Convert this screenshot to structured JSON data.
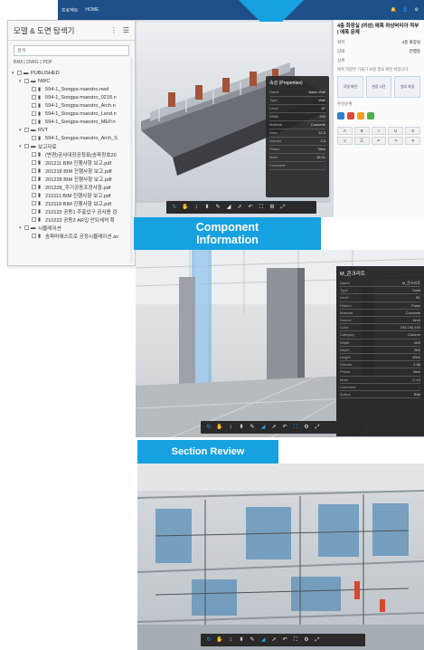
{
  "app": {
    "menu_label": "프로젝트",
    "home_label": "HOME"
  },
  "explorer": {
    "title": "모델 & 도면 탐색기",
    "search_placeholder": "검색",
    "filters": "BIM | DWG | PDF",
    "nodes": [
      {
        "level": 0,
        "toggle": "▾",
        "type": "folder",
        "label": "PUBLISHED"
      },
      {
        "level": 1,
        "toggle": "▾",
        "type": "folder",
        "label": "NWC"
      },
      {
        "level": 2,
        "toggle": "",
        "type": "file",
        "label": "594-1_Songpa maestro.nwd"
      },
      {
        "level": 2,
        "toggle": "",
        "type": "file",
        "label": "594-1_Songpa maestro_0218.n"
      },
      {
        "level": 2,
        "toggle": "",
        "type": "file",
        "label": "594-1_Songpa maestro_Arch.n"
      },
      {
        "level": 2,
        "toggle": "",
        "type": "file",
        "label": "594-1_Songpa maestro_Land.n"
      },
      {
        "level": 2,
        "toggle": "",
        "type": "file",
        "label": "594-1_Songpa maestro_MEP.n"
      },
      {
        "level": 1,
        "toggle": "▾",
        "type": "folder",
        "label": "RVT"
      },
      {
        "level": 2,
        "toggle": "",
        "type": "file",
        "label": "594-1_Songpa maestro_Arch_S"
      },
      {
        "level": 1,
        "toggle": "▾",
        "type": "folder",
        "label": "보고자료"
      },
      {
        "level": 2,
        "toggle": "",
        "type": "file",
        "label": "(변경)공사대장공정표(송파창호20"
      },
      {
        "level": 2,
        "toggle": "",
        "type": "file",
        "label": "201211 BIM 진행사항 보고.pdf"
      },
      {
        "level": 2,
        "toggle": "",
        "type": "file",
        "label": "201218 BIM 진행사항 보고.pdf"
      },
      {
        "level": 2,
        "toggle": "",
        "type": "file",
        "label": "201228 BIM 진행사항 보고.pdf"
      },
      {
        "level": 2,
        "toggle": "",
        "type": "file",
        "label": "201228_주기공동조정사항.pdf"
      },
      {
        "level": 2,
        "toggle": "",
        "type": "file",
        "label": "210111 BIM 진행사항 보고.pdf"
      },
      {
        "level": 2,
        "toggle": "",
        "type": "file",
        "label": "210118 BIM 진행사항 보고.pdf"
      },
      {
        "level": 2,
        "toggle": "",
        "type": "file",
        "label": "210122 공동1 주출입구 공사용 검"
      },
      {
        "level": 2,
        "toggle": "",
        "type": "file",
        "label": "210222 공동2 AR입 안되세처 확"
      },
      {
        "level": 1,
        "toggle": "▾",
        "type": "folder",
        "label": "시뮬레이션"
      },
      {
        "level": 2,
        "toggle": "",
        "type": "file",
        "label": "송파마에스트로 공정시뮬레이션.av"
      }
    ]
  },
  "banners": {
    "component_line1": "Component",
    "component_line2": "Information",
    "section_review": "Section Review"
  },
  "top_panel": {
    "title": "4층 화장실 (여성) 에폭 좌상버티아 적부 | 에폭 문제",
    "field1_label": "위치",
    "field1_value": "4층 화장실",
    "field2_label": "상태",
    "field2_value": "진행중",
    "desc_label": "상세",
    "desc": "에폭 마감면 기울기 보정 필요 확인 바랍니다.",
    "thumb1": "모델 화면",
    "thumb2": "현장 사진",
    "thumb3": "첨부 파일",
    "priority_label": "우선순위",
    "colors": [
      "#2f7fd1",
      "#e04a3a",
      "#f0a020",
      "#4caf50"
    ]
  },
  "info_popup_top": {
    "title": "속성 (Properties)",
    "rows": [
      {
        "k": "Name",
        "v": "Basic Wall"
      },
      {
        "k": "Type",
        "v": "Wall"
      },
      {
        "k": "Level",
        "v": "4F"
      },
      {
        "k": "Width",
        "v": "200"
      },
      {
        "k": "Material",
        "v": "Concrete"
      },
      {
        "k": "Area",
        "v": "12.5"
      },
      {
        "k": "Volume",
        "v": "2.5"
      },
      {
        "k": "Phase",
        "v": "New"
      },
      {
        "k": "Mark",
        "v": "W-01"
      },
      {
        "k": "Comment",
        "v": "-"
      }
    ]
  },
  "info_popup_mid": {
    "title": "M_콘크리트",
    "rows": [
      {
        "k": "Name",
        "v": "M_콘크리트"
      },
      {
        "k": "Type",
        "v": "Solid"
      },
      {
        "k": "Level",
        "v": "B1"
      },
      {
        "k": "Hidden",
        "v": "False"
      },
      {
        "k": "Material",
        "v": "Concrete"
      },
      {
        "k": "Source",
        "v": "Arch"
      },
      {
        "k": "Color",
        "v": "192,192,192"
      },
      {
        "k": "Category",
        "v": "Column"
      },
      {
        "k": "Width",
        "v": "800"
      },
      {
        "k": "Depth",
        "v": "800"
      },
      {
        "k": "Height",
        "v": "4500"
      },
      {
        "k": "Volume",
        "v": "2.88"
      },
      {
        "k": "Phase",
        "v": "New"
      },
      {
        "k": "Mark",
        "v": "C-12"
      },
      {
        "k": "Comment",
        "v": "-"
      },
      {
        "k": "Author",
        "v": "BIM"
      }
    ]
  },
  "toolbar_icons": [
    "↻",
    "✋",
    "↕",
    "⬍",
    "✎",
    "◢",
    "➚",
    "↶",
    "⛶",
    "⚙",
    "⤢"
  ]
}
